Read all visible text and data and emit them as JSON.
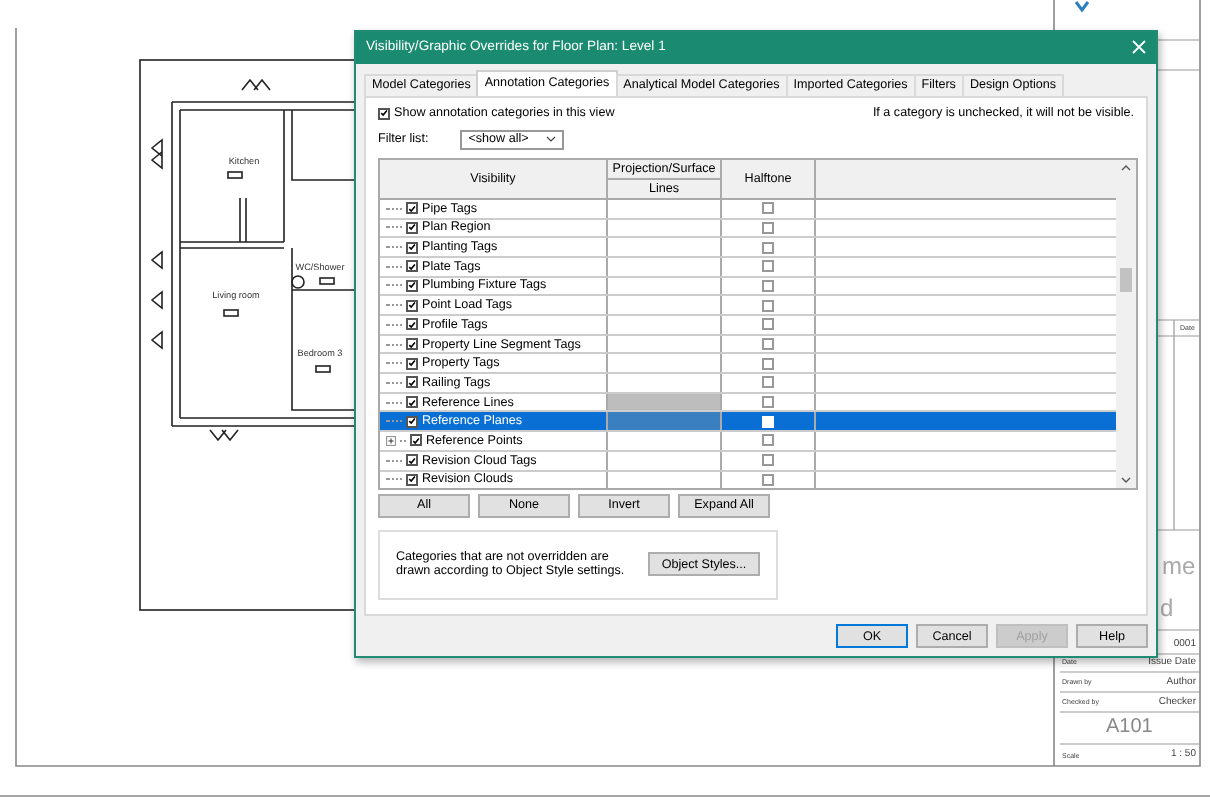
{
  "sheet": {
    "rooms": [
      {
        "name": "Kitchen"
      },
      {
        "name": "Living room"
      },
      {
        "name": "WC/Shower"
      },
      {
        "name": "Bedroom 3"
      }
    ],
    "title_block": {
      "revision_header": "Date",
      "name_fragments": [
        "me",
        "d"
      ],
      "project_number": "0001",
      "fields": [
        {
          "label": "Date",
          "value": "Issue Date"
        },
        {
          "label": "Drawn by",
          "value": "Author"
        },
        {
          "label": "Checked by",
          "value": "Checker"
        }
      ],
      "sheet_number": "A101",
      "scale": {
        "label": "Scale",
        "value": "1 : 50"
      }
    }
  },
  "dialog": {
    "title": "Visibility/Graphic Overrides for Floor Plan: Level 1",
    "tabs": [
      {
        "label": "Model Categories",
        "selected": false
      },
      {
        "label": "Annotation Categories",
        "selected": true
      },
      {
        "label": "Analytical Model Categories",
        "selected": false
      },
      {
        "label": "Imported Categories",
        "selected": false
      },
      {
        "label": "Filters",
        "selected": false
      },
      {
        "label": "Design Options",
        "selected": false
      }
    ],
    "show_categories": {
      "label": "Show annotation categories in this view",
      "checked": true
    },
    "note": "If a category is unchecked, it will not be visible.",
    "filter": {
      "label": "Filter list:",
      "value": "<show all>"
    },
    "table": {
      "visibility_header": "Visibility",
      "projection_header": "Projection/Surface",
      "lines_header": "Lines",
      "halftone_header": "Halftone",
      "rows": [
        {
          "name": "Pipe Tags",
          "visible": true,
          "halftone": false,
          "selected": false,
          "expandable": false,
          "lines_disabled": false
        },
        {
          "name": "Plan Region",
          "visible": true,
          "halftone": false,
          "selected": false,
          "expandable": false,
          "lines_disabled": false
        },
        {
          "name": "Planting Tags",
          "visible": true,
          "halftone": false,
          "selected": false,
          "expandable": false,
          "lines_disabled": false
        },
        {
          "name": "Plate Tags",
          "visible": true,
          "halftone": false,
          "selected": false,
          "expandable": false,
          "lines_disabled": false
        },
        {
          "name": "Plumbing Fixture Tags",
          "visible": true,
          "halftone": false,
          "selected": false,
          "expandable": false,
          "lines_disabled": false
        },
        {
          "name": "Point Load Tags",
          "visible": true,
          "halftone": false,
          "selected": false,
          "expandable": false,
          "lines_disabled": false
        },
        {
          "name": "Profile Tags",
          "visible": true,
          "halftone": false,
          "selected": false,
          "expandable": false,
          "lines_disabled": false
        },
        {
          "name": "Property Line Segment Tags",
          "visible": true,
          "halftone": false,
          "selected": false,
          "expandable": false,
          "lines_disabled": false
        },
        {
          "name": "Property Tags",
          "visible": true,
          "halftone": false,
          "selected": false,
          "expandable": false,
          "lines_disabled": false
        },
        {
          "name": "Railing Tags",
          "visible": true,
          "halftone": false,
          "selected": false,
          "expandable": false,
          "lines_disabled": false
        },
        {
          "name": "Reference Lines",
          "visible": true,
          "halftone": false,
          "selected": false,
          "expandable": false,
          "lines_disabled": true
        },
        {
          "name": "Reference Planes",
          "visible": true,
          "halftone": false,
          "selected": true,
          "expandable": false,
          "lines_disabled": false
        },
        {
          "name": "Reference Points",
          "visible": true,
          "halftone": false,
          "selected": false,
          "expandable": true,
          "lines_disabled": false
        },
        {
          "name": "Revision Cloud Tags",
          "visible": true,
          "halftone": false,
          "selected": false,
          "expandable": false,
          "lines_disabled": false
        },
        {
          "name": "Revision Clouds",
          "visible": true,
          "halftone": false,
          "selected": false,
          "expandable": false,
          "lines_disabled": false
        }
      ]
    },
    "table_buttons": [
      "All",
      "None",
      "Invert",
      "Expand All"
    ],
    "info": {
      "text": "Categories that are not overridden are drawn according to Object Style settings.",
      "button": "Object Styles..."
    },
    "buttons": [
      {
        "label": "OK",
        "default": true,
        "disabled": false
      },
      {
        "label": "Cancel",
        "default": false,
        "disabled": false
      },
      {
        "label": "Apply",
        "default": false,
        "disabled": true
      },
      {
        "label": "Help",
        "default": false,
        "disabled": false
      }
    ]
  }
}
